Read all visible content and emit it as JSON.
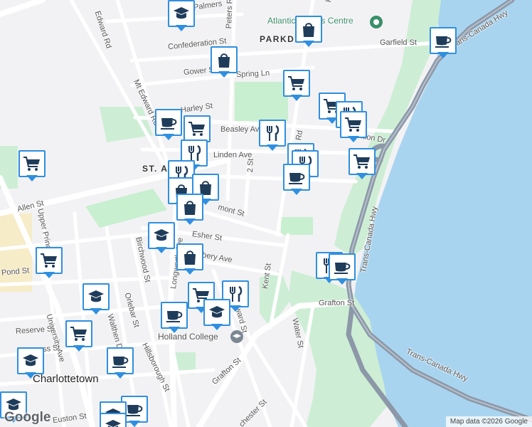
{
  "map": {
    "neighbourhoods": [
      "PARKDALE",
      "ST. AVENUES"
    ],
    "neighbourhood_visible": [
      "PARKDA",
      "ST. A"
    ],
    "city": "Charlottetown",
    "pois": {
      "atlantic_fitness": "Atlantic Fitness Centre",
      "holland_college": "Holland College"
    },
    "streets": {
      "edward_rd": "Edward Rd",
      "palmers": "Palmers",
      "peters_rd": "Peters Rd",
      "confederation_st": "Confederation St",
      "garfield_st": "Garfield St",
      "gower_st": "Gower St",
      "spring_ln": "Spring Ln",
      "mt_edward_rd": "Mt Edward Rd",
      "harley_st": "Harley St",
      "beasley_ave": "Beasley Ave",
      "exhibition_dr": "Exhibition Dr",
      "linden_ave": "Linden Ave",
      "second_st": "2 St",
      "allen_st": "Allen St",
      "belmont_st": "mont St",
      "esher_st": "Esher St",
      "longworth_ave": "Longworth Ave",
      "upper_prince": "Upper Prince",
      "birchwood_st": "Birchwood St",
      "bery_ave": "bery Ave",
      "pond_st": "Pond St",
      "kent_st": "Kent St",
      "grafton_st": "Grafton St",
      "grafton_st2": "Grafton St",
      "water_st": "Water St",
      "trans_canada_hwy": "Trans-Canada Hwy",
      "trans_canada_hwy2": "Trans-Canada Hwy",
      "trans_canada_hwy3": "Trans-Canada Hwy",
      "reserve_st": "Reserve St",
      "university_ave": "University Ave",
      "walthen_dr": "Walthen Dr",
      "orlebar_st": "Orlebar St",
      "hillsborough_st": "Hillsborough St",
      "euston_st": "Euston St",
      "ward_st": "ward St",
      "dorchester_st": "chester St",
      "ss_st": "ss St",
      "kensington_rd": "Ke",
      "exhibition_rd": "Rd"
    },
    "markers": [
      {
        "type": "school-icon"
      },
      {
        "type": "shopping-bag-icon"
      },
      {
        "type": "coffee-icon"
      },
      {
        "type": "shopping-bag-icon"
      },
      {
        "type": "shopping-cart-icon"
      },
      {
        "type": "shopping-cart-icon"
      },
      {
        "type": "restaurant-icon"
      },
      {
        "type": "shopping-cart-icon"
      },
      {
        "type": "coffee-icon"
      },
      {
        "type": "shopping-cart-icon"
      },
      {
        "type": "restaurant-icon"
      },
      {
        "type": "restaurant-icon"
      },
      {
        "type": "shopping-cart-icon"
      },
      {
        "type": "restaurant-icon"
      },
      {
        "type": "restaurant-icon"
      },
      {
        "type": "restaurant-icon"
      },
      {
        "type": "shopping-cart-icon"
      },
      {
        "type": "coffee-icon"
      },
      {
        "type": "shopping-bag-icon"
      },
      {
        "type": "shopping-bag-icon"
      },
      {
        "type": "shopping-bag-icon"
      },
      {
        "type": "school-icon"
      },
      {
        "type": "shopping-bag-icon"
      },
      {
        "type": "shopping-cart-icon"
      },
      {
        "type": "restaurant-icon"
      },
      {
        "type": "coffee-icon"
      },
      {
        "type": "shopping-cart-icon"
      },
      {
        "type": "restaurant-icon"
      },
      {
        "type": "school-icon"
      },
      {
        "type": "coffee-icon"
      },
      {
        "type": "school-icon"
      },
      {
        "type": "shopping-cart-icon"
      },
      {
        "type": "school-icon"
      },
      {
        "type": "coffee-icon"
      },
      {
        "type": "school-icon"
      },
      {
        "type": "coffee-icon"
      },
      {
        "type": "school-icon"
      },
      {
        "type": "school-icon"
      }
    ],
    "brand": "Google",
    "attribution": "Map data ©2026 Google",
    "colors": {
      "water": "#a9d4ef",
      "park": "#c8efd0",
      "marker_border": "#2f8fe0",
      "marker_icon": "#1f3c5a",
      "highway": "#8c98a8"
    }
  }
}
